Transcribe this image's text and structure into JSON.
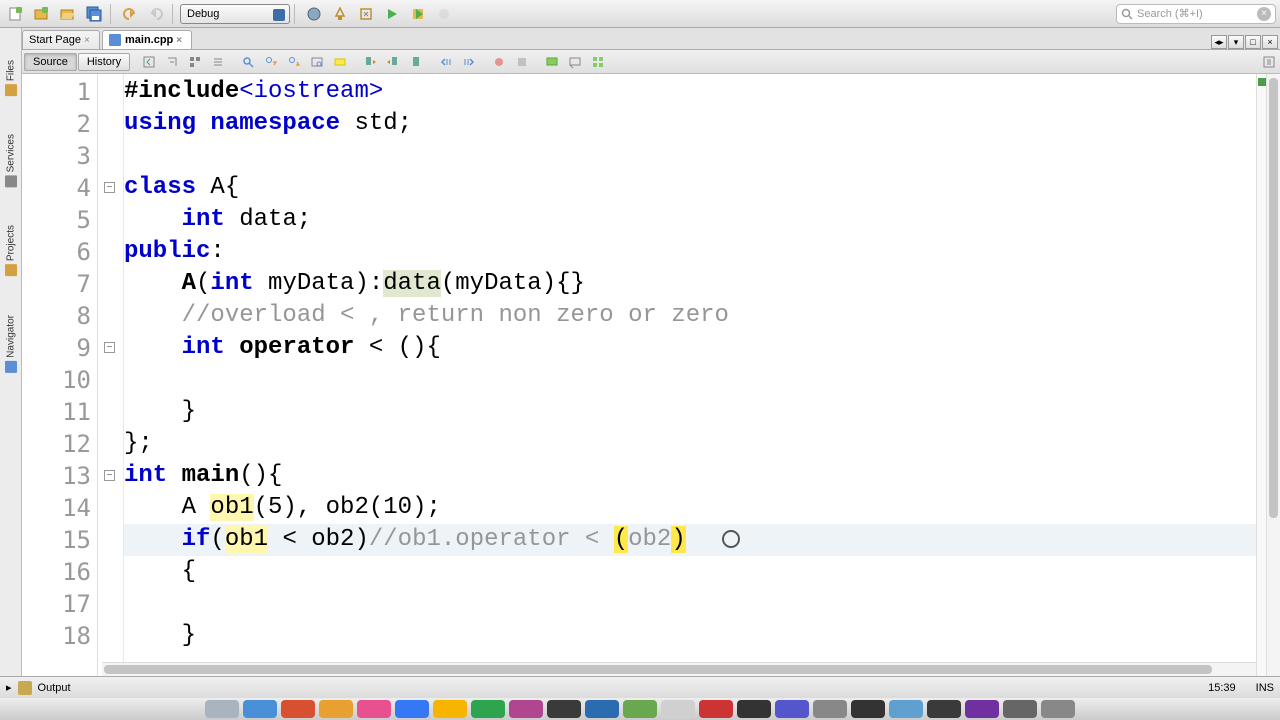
{
  "toolbar": {
    "config_label": "Debug"
  },
  "search": {
    "placeholder": "Search (⌘+I)"
  },
  "tabs": [
    {
      "label": "Start Page",
      "active": false
    },
    {
      "label": "main.cpp",
      "active": true
    }
  ],
  "side_tabs": [
    "Files",
    "Services",
    "Projects",
    "Navigator"
  ],
  "editor_tabs": {
    "source": "Source",
    "history": "History"
  },
  "line_start": 1,
  "line_count": 18,
  "code_lines": [
    [
      {
        "c": "pp",
        "t": "#include"
      },
      {
        "c": "kw2",
        "t": "<iostream>"
      }
    ],
    [
      {
        "c": "kw",
        "t": "using"
      },
      {
        "c": "",
        "t": " "
      },
      {
        "c": "kw",
        "t": "namespace"
      },
      {
        "c": "",
        "t": " std;"
      }
    ],
    [],
    [
      {
        "c": "kw",
        "t": "class"
      },
      {
        "c": "",
        "t": " A{"
      }
    ],
    [
      {
        "c": "",
        "t": "    "
      },
      {
        "c": "kw",
        "t": "int"
      },
      {
        "c": "",
        "t": " data;"
      }
    ],
    [
      {
        "c": "kw",
        "t": "public"
      },
      {
        "c": "",
        "t": ":"
      }
    ],
    [
      {
        "c": "",
        "t": "    "
      },
      {
        "c": "fn",
        "t": "A"
      },
      {
        "c": "",
        "t": "("
      },
      {
        "c": "kw",
        "t": "int"
      },
      {
        "c": "",
        "t": " myData):"
      },
      {
        "c": "hl2",
        "t": "data"
      },
      {
        "c": "",
        "t": "(myData){}"
      }
    ],
    [
      {
        "c": "",
        "t": "    "
      },
      {
        "c": "cm",
        "t": "//overload < , return non zero or zero"
      }
    ],
    [
      {
        "c": "",
        "t": "    "
      },
      {
        "c": "kw",
        "t": "int"
      },
      {
        "c": "",
        "t": " "
      },
      {
        "c": "fn",
        "t": "operator"
      },
      {
        "c": "",
        "t": " < (){"
      }
    ],
    [],
    [
      {
        "c": "",
        "t": "    }"
      }
    ],
    [
      {
        "c": "",
        "t": "};"
      }
    ],
    [
      {
        "c": "kw",
        "t": "int"
      },
      {
        "c": "",
        "t": " "
      },
      {
        "c": "fn",
        "t": "main"
      },
      {
        "c": "",
        "t": "(){"
      }
    ],
    [
      {
        "c": "",
        "t": "    A "
      },
      {
        "c": "hl",
        "t": "ob1"
      },
      {
        "c": "",
        "t": "(5), ob2(10);"
      }
    ],
    [
      {
        "c": "",
        "t": "    "
      },
      {
        "c": "kw",
        "t": "if"
      },
      {
        "c": "",
        "t": "("
      },
      {
        "c": "hl",
        "t": "ob1"
      },
      {
        "c": "",
        "t": " < ob2)"
      },
      {
        "c": "cm",
        "t": "//ob1.operator < "
      },
      {
        "c": "bracket-hl",
        "t": "("
      },
      {
        "c": "cm",
        "t": "ob2"
      },
      {
        "c": "bracket-hl",
        "t": ")"
      }
    ],
    [
      {
        "c": "",
        "t": "    {"
      }
    ],
    [],
    [
      {
        "c": "",
        "t": "    }"
      }
    ]
  ],
  "fold_marks": [
    4,
    9,
    13
  ],
  "current_line": 15,
  "status": {
    "output": "Output",
    "pos": "15:39",
    "mode": "INS"
  },
  "dock_colors": [
    "#a8b4c0",
    "#4a90d9",
    "#d85030",
    "#e8a030",
    "#e85090",
    "#3478f6",
    "#f7b500",
    "#2ea44f",
    "#b04590",
    "#3a3a3a",
    "#2b6cb0",
    "#6aa84f",
    "#d0d0d0",
    "#cc3333",
    "#333333",
    "#5555cc",
    "#888888",
    "#333333",
    "#60a0d0",
    "#3a3a3a",
    "#7030a0",
    "#666",
    "#888"
  ]
}
